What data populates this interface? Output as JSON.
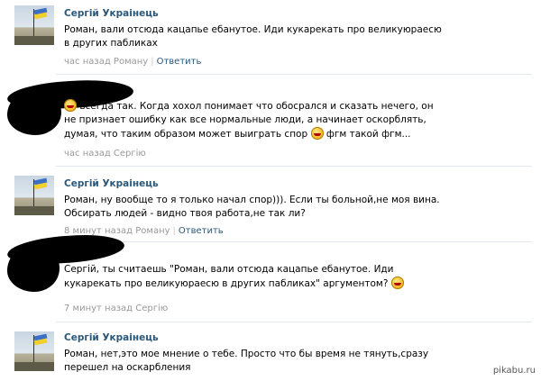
{
  "comments": [
    {
      "author": "Сергій Украінець",
      "text": "Роман, вали отсюда кацапье ебанутое. Иди кукарекать про великуюраесю в других пабликах",
      "time": "час назад Роману",
      "reply": "Ответить"
    },
    {
      "text_before_smile": "всегда так. Когда хохол понимает что обосрался и сказать нечего, он не признает ошибку как все нормальные люди, а начинает оскорблять, думая, что таким образом может выиграть спор",
      "text_after_smile": "фгм такой фгм...",
      "time": "час назад Сергію"
    },
    {
      "author": "Сергій Украінець",
      "text": "Роман, ну вообще то я только начал спор))). Если ты больной,не моя вина. Обсирать людей - видно твоя работа,не так ли?",
      "time": "8 минут назад Роману",
      "reply": "Ответить"
    },
    {
      "text": "Сергій, ты считаешь \"Роман, вали отсюда кацапье ебанутое. Иди кукарекать про великуюраесю в других пабликах\" аргументом?",
      "time": "7 минут назад Сергію"
    },
    {
      "author": "Сергій Украінець",
      "text": "Роман, нет,это мое мнение о тебе. Просто что бы время не тянуть,сразу перешел на оскарбления"
    }
  ],
  "watermark": "pikabu.ru",
  "icons": {
    "smile": "smile-emoji-icon",
    "avatar": "flag-avatar"
  }
}
